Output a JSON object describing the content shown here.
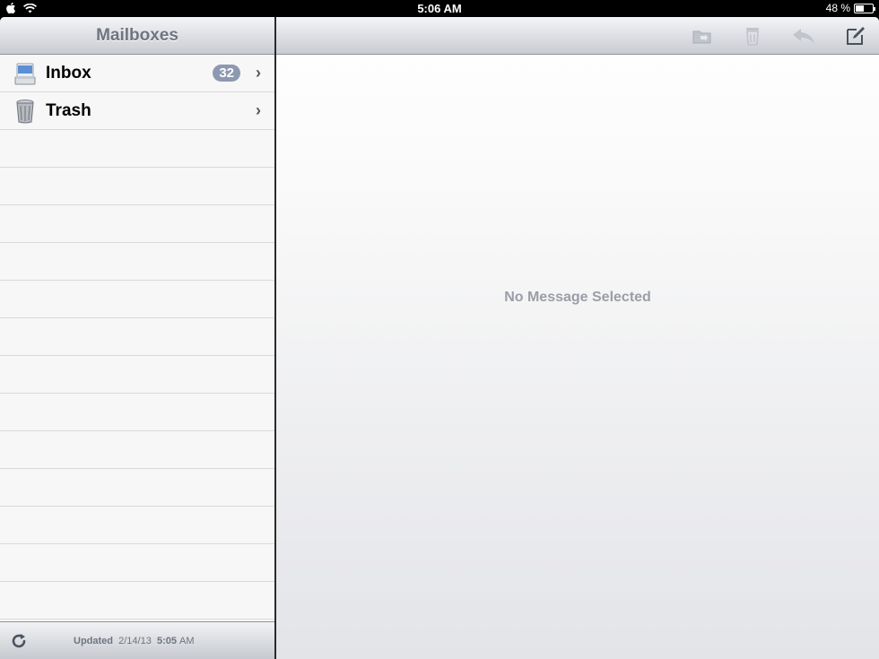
{
  "status_bar": {
    "time": "5:06 AM",
    "battery_percent": "48 %",
    "battery_level": 0.48
  },
  "sidebar": {
    "title": "Mailboxes",
    "items": [
      {
        "label": "Inbox",
        "badge": "32",
        "icon": "inbox-icon"
      },
      {
        "label": "Trash",
        "icon": "trash-can-icon"
      }
    ],
    "footer": {
      "updated_label": "Updated",
      "date": "2/14/13",
      "time": "5:05",
      "ampm": "AM"
    }
  },
  "detail": {
    "empty_message": "No Message Selected",
    "toolbar": {
      "icons": [
        "move-folder-icon",
        "trash-icon",
        "reply-icon",
        "compose-icon"
      ]
    }
  },
  "colors": {
    "badge": "#8c99b0",
    "toolbar_icon_disabled": "#b8bcc4",
    "toolbar_icon_enabled": "#4a5260"
  }
}
